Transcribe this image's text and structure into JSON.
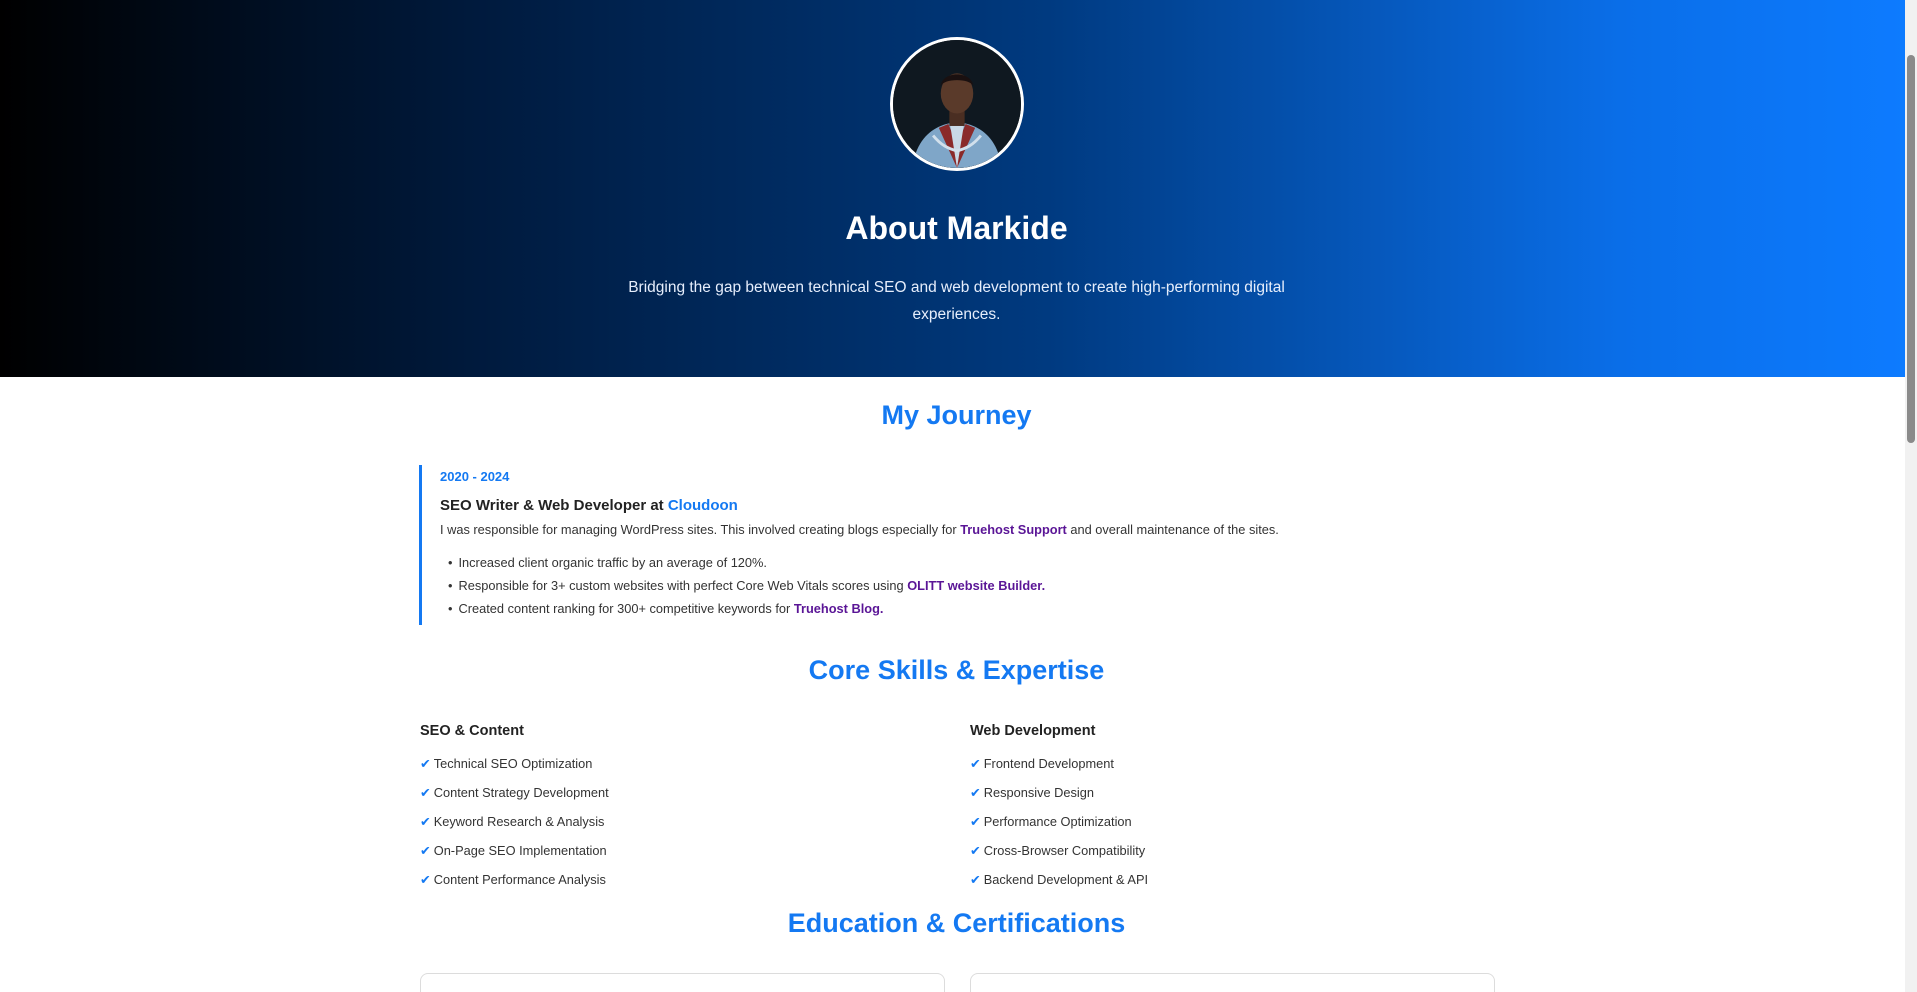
{
  "hero": {
    "title": "About Markide",
    "subtitle": "Bridging the gap between technical SEO and web development to create high-performing digital experiences.",
    "avatar_icon": "profile-photo"
  },
  "journey": {
    "title": "My Journey",
    "years": "2020 - 2024",
    "role_prefix": "SEO Writer & Web Developer at ",
    "company": "Cloudoon",
    "desc_prefix": "I was responsible for managing WordPress sites. This involved creating blogs especially for ",
    "desc_link": "Truehost Support",
    "desc_suffix": " and overall maintenance of the sites.",
    "bullet1": "Increased client organic traffic by an average of 120%.",
    "bullet2_prefix": "Responsible for 3+ custom websites with perfect Core Web Vitals scores using ",
    "bullet2_link": "OLITT website Builder.",
    "bullet3_prefix": "Created content ranking for 300+ competitive keywords for ",
    "bullet3_link": "Truehost Blog."
  },
  "skills": {
    "title": "Core Skills & Expertise",
    "check_glyph": "✔",
    "left": {
      "heading": "SEO & Content",
      "items": [
        "Technical SEO Optimization",
        "Content Strategy Development",
        "Keyword Research & Analysis",
        "On-Page SEO Implementation",
        "Content Performance Analysis"
      ]
    },
    "right": {
      "heading": "Web Development",
      "items": [
        "Frontend Development",
        "Responsive Design",
        "Performance Optimization",
        "Cross-Browser Compatibility",
        "Backend Development & API"
      ]
    }
  },
  "education": {
    "title": "Education & Certifications"
  },
  "colors": {
    "accent": "#1479f2",
    "link": "#5a1596",
    "hero_start": "#000000",
    "hero_end": "#0d7bff"
  }
}
